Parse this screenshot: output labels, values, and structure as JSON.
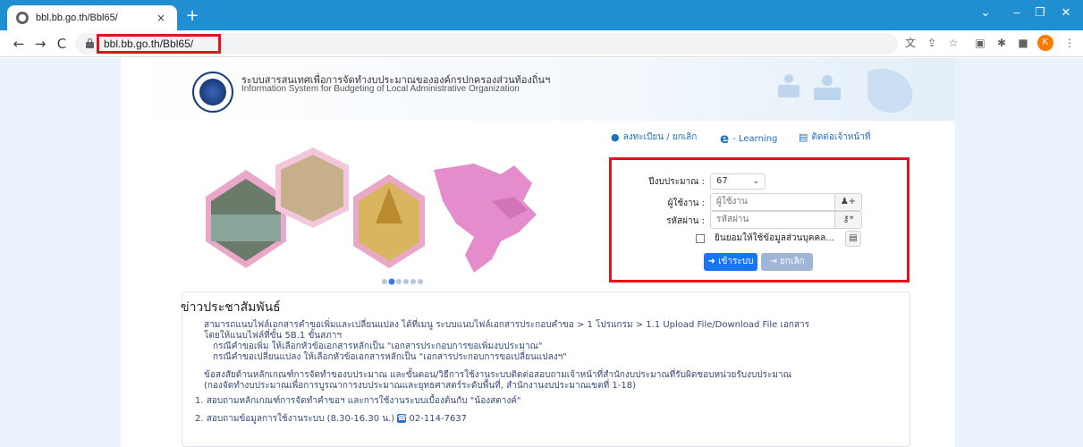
{
  "browser": {
    "tab_title": "bbl.bb.go.th/Bbl65/",
    "tab_close": "×",
    "new_tab": "+",
    "url": "bbl.bb.go.th/Bbl65/",
    "window_controls": [
      "⌄",
      "–",
      "❐",
      "✕"
    ],
    "profile_initial": "K",
    "icons": [
      "translate-icon",
      "share-icon",
      "star-icon",
      "extension-icon",
      "puzzle-icon",
      "sidepanel-icon",
      "profile-icon",
      "menu-icon"
    ]
  },
  "header": {
    "title_th": "ระบบสารสนเทศเพื่อการจัดทำงบประมาณขององค์กรปกครองส่วนท้องถิ่นฯ",
    "title_en": "Information System for Budgeting of Local Administrative Organization"
  },
  "quicklinks": {
    "register": "ลงทะเบียน / ยกเลิก",
    "elearning": "- Learning",
    "contact": "ติดต่อเจ้าหน้าที่"
  },
  "login": {
    "year_label": "ปีงบประมาณ :",
    "year_value": "67",
    "user_label": "ผู้ใช้งาน :",
    "user_placeholder": "ผู้ใช้งาน",
    "pass_label": "รหัสผ่าน :",
    "pass_placeholder": "รหัสผ่าน",
    "consent": "ยินยอมให้ใช้ข้อมูลส่วนบุคคล...",
    "login_button": "เข้าระบบ",
    "cancel_button": "ยกเลิก"
  },
  "news": {
    "title": "ข่าวประชาสัมพันธ์",
    "lines": [
      "สามารถแนบไฟล์เอกสารคำขอเพิ่มและเปลี่ยนแปลง ได้ที่เมนู ระบบแนบไฟล์เอกสารประกอบคำขอ > 1 โปรแกรม > 1.1 Upload File/Download File เอกสาร",
      "โดยให้แนบไฟล์ที่ขั้น 5B.1 ขั้นสภาฯ",
      "กรณีคำขอเพิ่ม ให้เลือกหัวข้อเอกสารหลักเป็น \"เอกสารประกอบการขอเพิ่มงบประมาณ\"",
      "กรณีคำขอเปลี่ยนแปลง ให้เลือกหัวข้อเอกสารหลักเป็น \"เอกสารประกอบการขอเปลี่ยนแปลงฯ\"",
      "ข้อสงสัยด้านหลักเกณฑ์การจัดทำของบประมาณ และขั้นตอน/วิธีการใช้งานระบบติดต่อสอบถามเจ้าหน้าที่สำนักงบประมาณที่รับผิดชอบหน่วยรับงบประมาณ",
      "(กองจัดทำงบประมาณเพื่อการบูรณาการงบประมาณและยุทธศาสตร์ระดับพื้นที่, สำนักงานงบประมาณเขตที่ 1-18)",
      "1. สอบถามหลักเกณฑ์การจัดทำคำขอฯ และการใช้งานระบบเบื้องต้นกับ \"น้องสตางค์\"",
      "2. สอบถามข้อมูลการใช้งานระบบ (8.30-16.30 น.)",
      "02-114-7637"
    ]
  },
  "colors": {
    "chrome_blue": "#1f8fd2",
    "highlight_red": "#e0141b",
    "primary_button": "#1976f2",
    "link_blue": "#1d6fbf",
    "map_pink": "#e58ccc"
  }
}
